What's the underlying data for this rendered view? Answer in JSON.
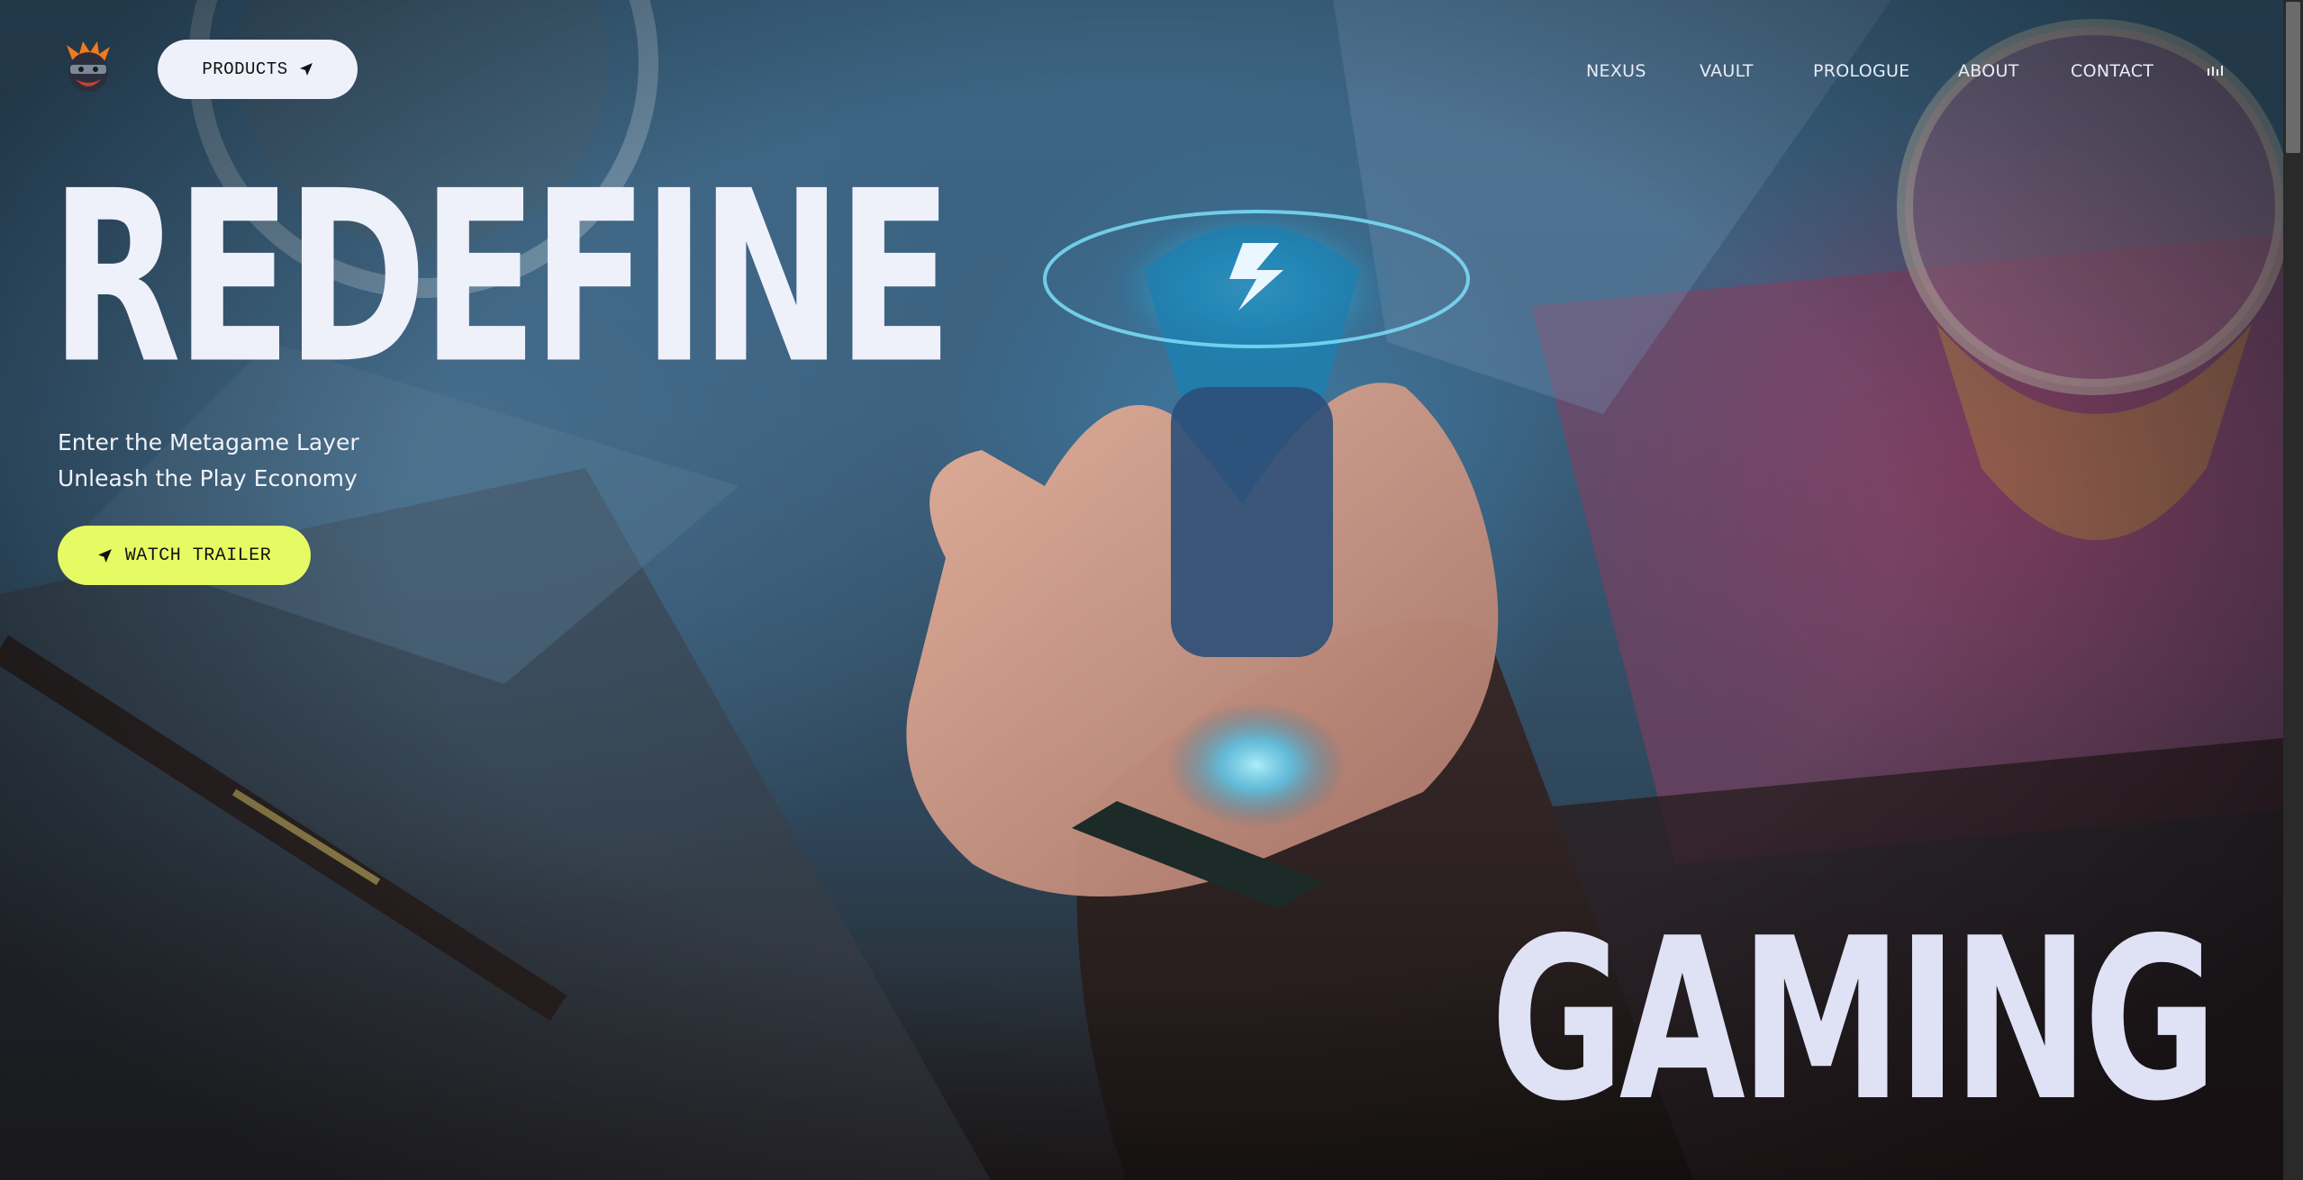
{
  "header": {
    "logo_icon": "ninja-avatar-icon",
    "products_label": "PRODUCTS",
    "products_icon": "send-arrow-icon"
  },
  "nav": {
    "items": [
      "NEXUS",
      "VAULT",
      "PROLOGUE",
      "ABOUT",
      "CONTACT"
    ],
    "audio_icon": "audio-bars-icon"
  },
  "hero": {
    "headline_top": "REDEFINE",
    "headline_bottom": "GAMING",
    "subtitle_line1": "Enter the Metagame Layer",
    "subtitle_line2": "Unleash the Play Economy",
    "trailer_label": "WATCH TRAILER",
    "trailer_icon": "send-arrow-icon"
  },
  "colors": {
    "accent_yellow": "#e6fa64",
    "pill_white": "#eef0fa",
    "headline": "#eef0fa",
    "glow": "#3fd0ff"
  }
}
